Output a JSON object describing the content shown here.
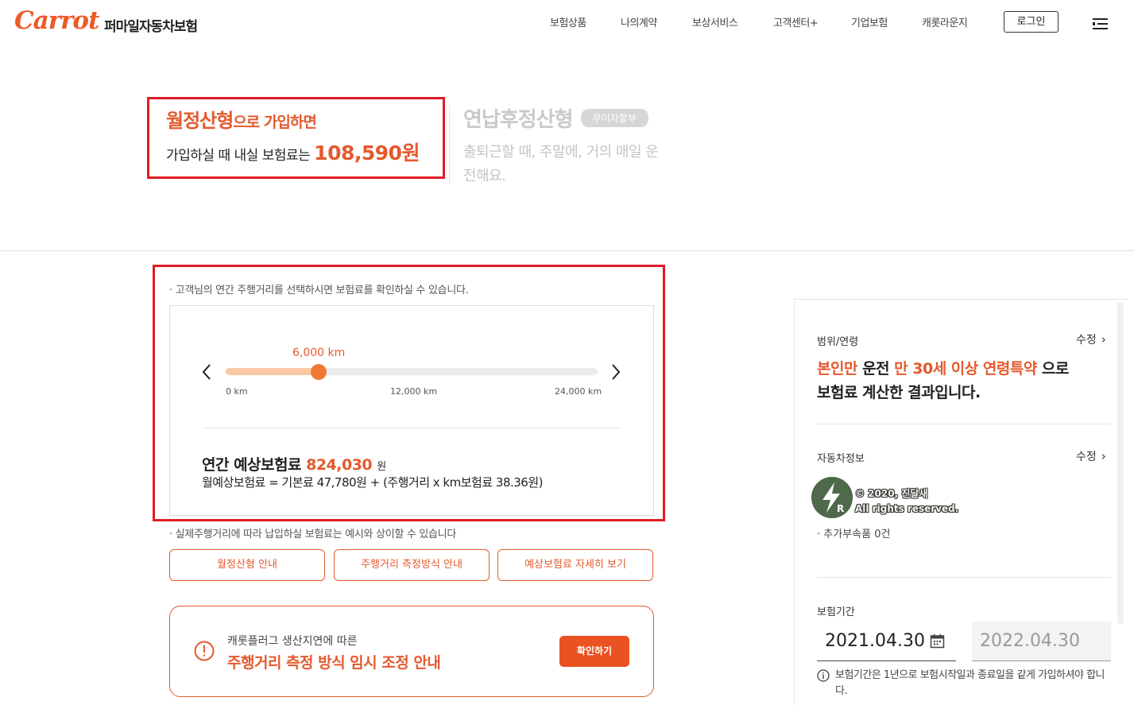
{
  "header": {
    "logo_text": "Carrot",
    "brand_sub": "퍼마일자동차보험",
    "nav": [
      "보험상품",
      "나의계약",
      "보상서비스",
      "고객센터+",
      "기업보험",
      "캐롯라운지"
    ],
    "login_label": "로그인",
    "menu_icon": "menu-icon"
  },
  "plans": {
    "monthly": {
      "title_main": "월정산형",
      "title_suffix": "으로 가입하면",
      "line_prefix": "가입하실 때 내실 보험료는",
      "price": "108,590원"
    },
    "annual": {
      "title": "연납후정산형",
      "badge": "무이자할부",
      "desc": "출퇴근할 때, 주말에, 거의 매일 운전해요."
    }
  },
  "distance": {
    "note": "고객님의 연간 주행거리를 선택하시면 보험료를 확인하실 수 있습니다.",
    "slider": {
      "min": 0,
      "max": 24000,
      "value": 6000,
      "value_label": "6,000 km"
    },
    "ticks": [
      "0 km",
      "12,000 km",
      "24,000 km"
    ],
    "annual_premium_label": "연간 예상보험료",
    "annual_premium_value": "824,030",
    "annual_premium_unit": "원",
    "formula": "월예상보험료 = 기본료 47,780원 + (주행거리 x km보험료 38.36원)"
  },
  "disclaimer": "실제주행거리에 따라 납입하실 보험료는 예시와 상이할 수 있습니다",
  "buttons": [
    "월정산형 안내",
    "주행거리 측정방식 안내",
    "예상보험료 자세히 보기"
  ],
  "notice": {
    "subtitle": "캐롯플러그 생산지연에 따른",
    "title": "주행거리 측정 방식 임시 조정 안내",
    "button": "확인하기"
  },
  "summary": {
    "scope_label": "범위/연령",
    "edit_label": "수정",
    "scope": {
      "p1": "본인만",
      "p2": " 운전 ",
      "p3": "만 30세 이상 연령특약",
      "p4": " 으로",
      "line2": "보험료 계산한 결과입니다."
    },
    "vehicle_label": "자동차정보",
    "watermark_line1": "© 2020, 진달새",
    "watermark_line2": "All rights reserved.",
    "accessories": "추가부속품 0건",
    "period_label": "보험기간",
    "start_date": "2021.04.30",
    "end_date": "2022.04.30",
    "period_note": "보험기간은 1년으로 보험시작일과 종료일을 같게 가입하셔야 합니다."
  },
  "colors": {
    "accent": "#e4592d",
    "highlight_border": "#e01b25",
    "slider_fill": "#fbc9a6",
    "slider_thumb": "#f07a35"
  }
}
